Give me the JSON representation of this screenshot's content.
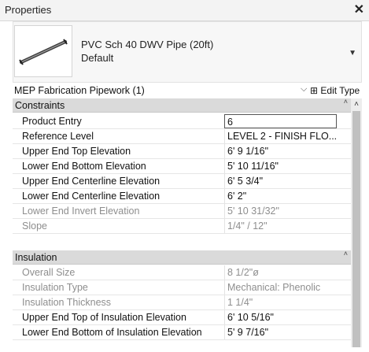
{
  "window": {
    "title": "Properties"
  },
  "type_selector": {
    "name": "PVC Sch 40 DWV Pipe (20ft)",
    "variant": "Default"
  },
  "filter": {
    "label": "MEP Fabrication Pipework (1)",
    "edit_type": "Edit Type"
  },
  "sections": [
    {
      "name": "Constraints",
      "rows": [
        {
          "name": "Product Entry",
          "value": "6",
          "editable": true
        },
        {
          "name": "Reference Level",
          "value": "LEVEL 2 - FINISH FLO...",
          "editable": true
        },
        {
          "name": "Upper End Top Elevation",
          "value": "6'  9 1/16\"",
          "editable": true
        },
        {
          "name": "Lower End Bottom Elevation",
          "value": "5'  10 11/16\"",
          "editable": true
        },
        {
          "name": "Upper End Centerline Elevation",
          "value": "6'  5 3/4\"",
          "editable": true
        },
        {
          "name": "Lower End Centerline Elevation",
          "value": "6'  2\"",
          "editable": true
        },
        {
          "name": "Lower End Invert Elevation",
          "value": "5'  10 31/32\"",
          "editable": false
        },
        {
          "name": "Slope",
          "value": "1/4\" / 12\"",
          "editable": false
        }
      ]
    },
    {
      "name": "Insulation",
      "rows": [
        {
          "name": "Overall Size",
          "value": "8 1/2\"ø",
          "editable": false
        },
        {
          "name": "Insulation Type",
          "value": "Mechanical: Phenolic",
          "editable": false
        },
        {
          "name": "Insulation Thickness",
          "value": "1 1/4\"",
          "editable": false
        },
        {
          "name": "Upper End Top of Insulation Elevation",
          "value": "6'  10 5/16\"",
          "editable": true
        },
        {
          "name": "Lower End Bottom of Insulation Elevation",
          "value": "5'  9 7/16\"",
          "editable": true
        }
      ]
    }
  ],
  "colors": {
    "section_bg": "#dadada",
    "dim_text": "#8e8e8e",
    "scrollbar": "#ededed"
  },
  "icons": {
    "close": "close-icon",
    "dropdown": "chevron-down-icon",
    "edit_type": "edit-type-icon",
    "scroll_up": "scroll-up-icon",
    "collapse": "collapse-icon"
  }
}
